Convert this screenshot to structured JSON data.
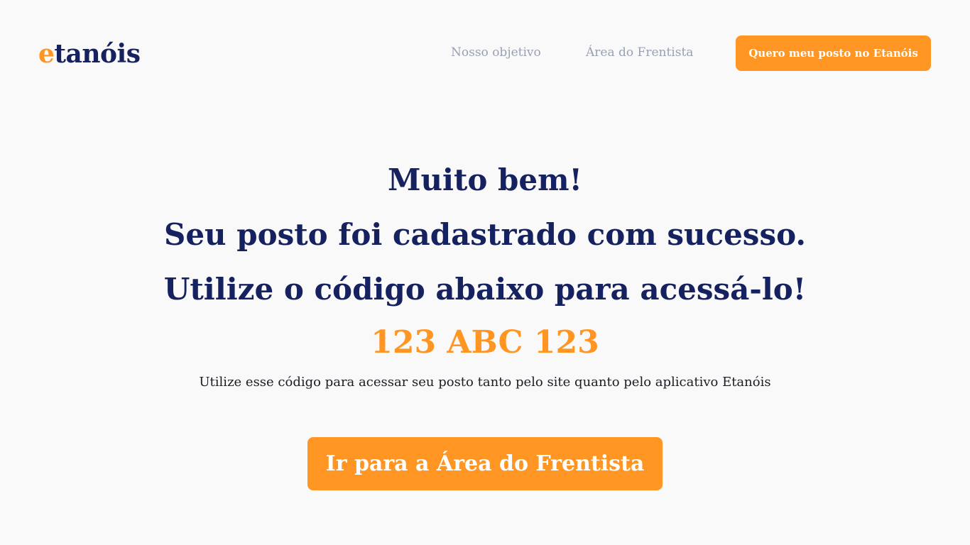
{
  "header": {
    "logo": {
      "first_letter": "e",
      "rest": "tanóis"
    },
    "nav": {
      "objetivo_label": "Nosso objetivo",
      "frentista_label": "Área do Frentista"
    },
    "cta_label": "Quero meu posto no Etanóis"
  },
  "hero": {
    "headline_lines": [
      "Muito bem!",
      "Seu posto foi cadastrado com sucesso.",
      "Utilize o código abaixo para acessá-lo!"
    ],
    "access_code": "123 ABC 123",
    "hint": "Utilize esse código para acessar seu posto tanto pelo site quanto pelo aplicativo Etanóis",
    "cta_label": "Ir para a Área do Frentista"
  },
  "colors": {
    "brand_orange": "#ff9624",
    "brand_navy": "#16215f",
    "nav_gray": "#9aa0b4",
    "background": "#f9f9f9"
  }
}
